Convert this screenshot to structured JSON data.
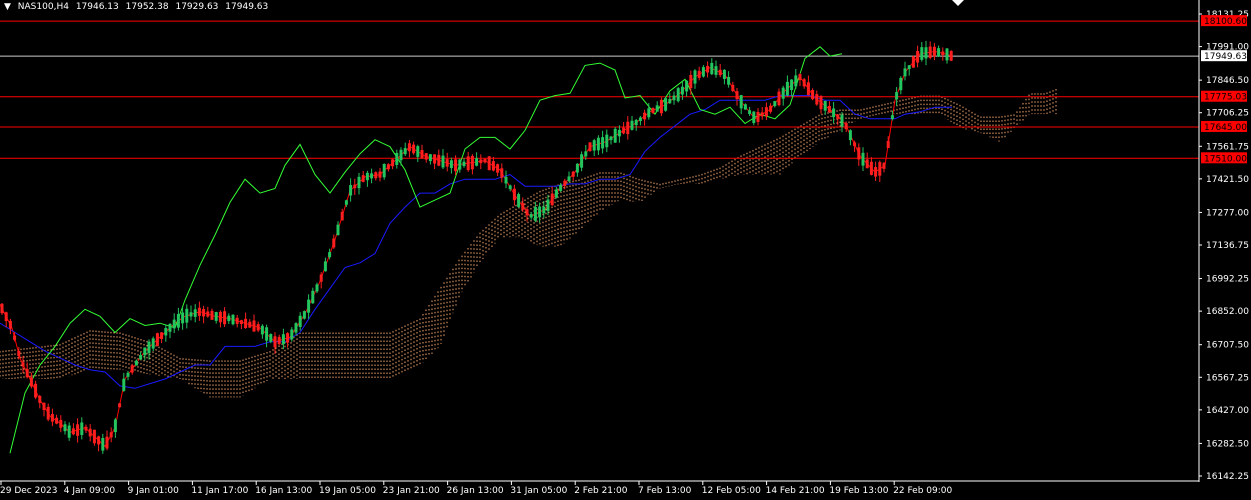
{
  "header": {
    "symbol": "NAS100,H4",
    "open": "17946.13",
    "high": "17952.38",
    "low": "17929.63",
    "close": "17949.63"
  },
  "colors": {
    "background": "#000000",
    "bull": "#22c55e",
    "bear": "#ff1e1e",
    "tenkan": "#ff0000",
    "kijun": "#1a1aff",
    "chikou": "#33ff33",
    "kumo": "#f4a56c",
    "level": "#ff0000",
    "current_price": "#cccccc"
  },
  "chart_data": {
    "type": "line",
    "title": "NAS100,H4",
    "xlabel": "",
    "ylabel": "",
    "ylim": [
      16142.25,
      18131.25
    ],
    "y_ticks": [
      "18131.25",
      "17991.00",
      "17846.50",
      "17706.25",
      "17561.75",
      "17421.50",
      "17277.00",
      "17136.75",
      "16992.25",
      "16852.00",
      "16707.50",
      "16567.25",
      "16427.00",
      "16282.50",
      "16142.25"
    ],
    "x_ticks": [
      "29 Dec 2023",
      "4 Jan 09:00",
      "9 Jan 01:00",
      "11 Jan 17:00",
      "16 Jan 13:00",
      "19 Jan 05:00",
      "23 Jan 21:00",
      "26 Jan 13:00",
      "31 Jan 05:00",
      "2 Feb 21:00",
      "7 Feb 13:00",
      "12 Feb 05:00",
      "14 Feb 21:00",
      "19 Feb 13:00",
      "22 Feb 09:00"
    ],
    "levels": [
      {
        "label": "18100.60",
        "value": 18100.6
      },
      {
        "label": "17775.03",
        "value": 17775.03
      },
      {
        "label": "17645.00",
        "value": 17645.0
      },
      {
        "label": "17510.00",
        "value": 17510.0
      }
    ],
    "current_price": {
      "label": "17949.63",
      "value": 17949.63
    },
    "series": [
      {
        "values": [
          [
            0,
            16880
          ],
          [
            12,
            16780
          ],
          [
            20,
            16650
          ],
          [
            30,
            16560
          ],
          [
            40,
            16470
          ],
          [
            50,
            16400
          ],
          [
            60,
            16370
          ],
          [
            70,
            16330
          ],
          [
            85,
            16350
          ],
          [
            95,
            16310
          ],
          [
            105,
            16270
          ],
          [
            115,
            16350
          ],
          [
            125,
            16560
          ],
          [
            135,
            16620
          ],
          [
            145,
            16680
          ],
          [
            155,
            16720
          ],
          [
            165,
            16760
          ],
          [
            175,
            16800
          ],
          [
            185,
            16830
          ],
          [
            200,
            16850
          ],
          [
            215,
            16830
          ],
          [
            230,
            16820
          ],
          [
            245,
            16800
          ],
          [
            260,
            16780
          ],
          [
            275,
            16720
          ],
          [
            290,
            16740
          ],
          [
            305,
            16840
          ],
          [
            320,
            16980
          ],
          [
            335,
            17160
          ],
          [
            350,
            17370
          ],
          [
            365,
            17430
          ],
          [
            380,
            17440
          ],
          [
            395,
            17500
          ],
          [
            410,
            17560
          ],
          [
            425,
            17520
          ],
          [
            440,
            17500
          ],
          [
            455,
            17480
          ],
          [
            470,
            17490
          ],
          [
            485,
            17500
          ],
          [
            500,
            17460
          ],
          [
            515,
            17350
          ],
          [
            530,
            17260
          ],
          [
            545,
            17290
          ],
          [
            560,
            17380
          ],
          [
            575,
            17450
          ],
          [
            590,
            17560
          ],
          [
            605,
            17580
          ],
          [
            620,
            17620
          ],
          [
            635,
            17660
          ],
          [
            650,
            17710
          ],
          [
            665,
            17740
          ],
          [
            680,
            17790
          ],
          [
            695,
            17860
          ],
          [
            710,
            17900
          ],
          [
            725,
            17870
          ],
          [
            740,
            17760
          ],
          [
            755,
            17680
          ],
          [
            770,
            17720
          ],
          [
            785,
            17800
          ],
          [
            800,
            17860
          ],
          [
            815,
            17770
          ],
          [
            830,
            17720
          ],
          [
            845,
            17660
          ],
          [
            860,
            17520
          ],
          [
            875,
            17450
          ],
          [
            885,
            17480
          ],
          [
            895,
            17760
          ],
          [
            905,
            17880
          ],
          [
            920,
            17960
          ],
          [
            935,
            17970
          ],
          [
            945,
            17960
          ],
          [
            952,
            17950
          ]
        ]
      },
      {
        "values": [
          [
            0,
            16800
          ],
          [
            15,
            16760
          ],
          [
            30,
            16720
          ],
          [
            45,
            16680
          ],
          [
            60,
            16650
          ],
          [
            75,
            16620
          ],
          [
            90,
            16600
          ],
          [
            105,
            16590
          ],
          [
            120,
            16530
          ],
          [
            135,
            16520
          ],
          [
            150,
            16540
          ],
          [
            165,
            16560
          ],
          [
            180,
            16590
          ],
          [
            195,
            16620
          ],
          [
            210,
            16620
          ],
          [
            225,
            16700
          ],
          [
            240,
            16700
          ],
          [
            255,
            16700
          ],
          [
            270,
            16720
          ],
          [
            285,
            16720
          ],
          [
            300,
            16760
          ],
          [
            315,
            16860
          ],
          [
            330,
            16950
          ],
          [
            345,
            17040
          ],
          [
            360,
            17060
          ],
          [
            375,
            17100
          ],
          [
            390,
            17230
          ],
          [
            405,
            17300
          ],
          [
            420,
            17360
          ],
          [
            435,
            17360
          ],
          [
            450,
            17400
          ],
          [
            465,
            17420
          ],
          [
            480,
            17420
          ],
          [
            495,
            17420
          ],
          [
            510,
            17440
          ],
          [
            525,
            17390
          ],
          [
            540,
            17390
          ],
          [
            555,
            17390
          ],
          [
            570,
            17400
          ],
          [
            585,
            17400
          ],
          [
            600,
            17420
          ],
          [
            615,
            17420
          ],
          [
            630,
            17440
          ],
          [
            645,
            17540
          ],
          [
            660,
            17600
          ],
          [
            675,
            17650
          ],
          [
            690,
            17700
          ],
          [
            705,
            17720
          ],
          [
            720,
            17760
          ],
          [
            735,
            17760
          ],
          [
            750,
            17760
          ],
          [
            765,
            17760
          ],
          [
            780,
            17780
          ],
          [
            795,
            17780
          ],
          [
            810,
            17780
          ],
          [
            825,
            17760
          ],
          [
            840,
            17760
          ],
          [
            855,
            17700
          ],
          [
            870,
            17680
          ],
          [
            885,
            17680
          ],
          [
            895,
            17680
          ],
          [
            905,
            17700
          ],
          [
            920,
            17710
          ],
          [
            935,
            17730
          ],
          [
            952,
            17730
          ]
        ]
      },
      {
        "values": [
          [
            10,
            16240
          ],
          [
            25,
            16500
          ],
          [
            40,
            16620
          ],
          [
            55,
            16700
          ],
          [
            70,
            16800
          ],
          [
            85,
            16860
          ],
          [
            100,
            16830
          ],
          [
            115,
            16760
          ],
          [
            130,
            16820
          ],
          [
            145,
            16790
          ],
          [
            160,
            16800
          ],
          [
            175,
            16780
          ],
          [
            185,
            16900
          ],
          [
            200,
            17050
          ],
          [
            215,
            17180
          ],
          [
            230,
            17320
          ],
          [
            245,
            17420
          ],
          [
            260,
            17360
          ],
          [
            275,
            17380
          ],
          [
            285,
            17480
          ],
          [
            300,
            17570
          ],
          [
            315,
            17440
          ],
          [
            330,
            17360
          ],
          [
            345,
            17450
          ],
          [
            360,
            17530
          ],
          [
            375,
            17590
          ],
          [
            390,
            17560
          ],
          [
            405,
            17460
          ],
          [
            420,
            17300
          ],
          [
            435,
            17330
          ],
          [
            450,
            17360
          ],
          [
            465,
            17550
          ],
          [
            480,
            17600
          ],
          [
            495,
            17600
          ],
          [
            510,
            17550
          ],
          [
            525,
            17630
          ],
          [
            540,
            17760
          ],
          [
            555,
            17780
          ],
          [
            570,
            17790
          ],
          [
            585,
            17910
          ],
          [
            600,
            17920
          ],
          [
            615,
            17890
          ],
          [
            625,
            17770
          ],
          [
            640,
            17780
          ],
          [
            655,
            17700
          ],
          [
            670,
            17800
          ],
          [
            685,
            17850
          ],
          [
            700,
            17720
          ],
          [
            715,
            17700
          ],
          [
            730,
            17730
          ],
          [
            745,
            17660
          ],
          [
            760,
            17700
          ],
          [
            775,
            17680
          ],
          [
            790,
            17740
          ],
          [
            805,
            17940
          ],
          [
            820,
            17990
          ],
          [
            830,
            17950
          ],
          [
            842,
            17960
          ]
        ]
      }
    ],
    "kumo_segments": [
      {
        "top": [
          [
            0,
            16680
          ],
          [
            60,
            16710
          ],
          [
            90,
            16770
          ],
          [
            120,
            16760
          ],
          [
            150,
            16720
          ],
          [
            180,
            16650
          ],
          [
            210,
            16640
          ],
          [
            240,
            16640
          ],
          [
            270,
            16680
          ],
          [
            300,
            16760
          ],
          [
            330,
            16760
          ],
          [
            360,
            16760
          ],
          [
            390,
            16760
          ],
          [
            420,
            16820
          ],
          [
            440,
            16950
          ],
          [
            460,
            17080
          ],
          [
            480,
            17190
          ],
          [
            500,
            17270
          ],
          [
            520,
            17320
          ],
          [
            540,
            17370
          ],
          [
            560,
            17400
          ],
          [
            580,
            17420
          ],
          [
            600,
            17450
          ],
          [
            620,
            17450
          ],
          [
            640,
            17420
          ],
          [
            660,
            17400
          ],
          [
            680,
            17420
          ],
          [
            700,
            17440
          ],
          [
            720,
            17470
          ],
          [
            740,
            17520
          ],
          [
            760,
            17560
          ],
          [
            780,
            17600
          ],
          [
            800,
            17650
          ],
          [
            820,
            17700
          ],
          [
            840,
            17720
          ],
          [
            860,
            17720
          ],
          [
            880,
            17740
          ],
          [
            900,
            17760
          ],
          [
            920,
            17780
          ],
          [
            940,
            17780
          ],
          [
            960,
            17740
          ],
          [
            980,
            17690
          ],
          [
            1000,
            17690
          ],
          [
            1015,
            17700
          ],
          [
            1030,
            17790
          ],
          [
            1045,
            17790
          ],
          [
            1057,
            17810
          ]
        ],
        "bottom": [
          [
            0,
            16560
          ],
          [
            60,
            16560
          ],
          [
            90,
            16600
          ],
          [
            120,
            16600
          ],
          [
            150,
            16580
          ],
          [
            180,
            16560
          ],
          [
            210,
            16480
          ],
          [
            240,
            16480
          ],
          [
            270,
            16560
          ],
          [
            300,
            16560
          ],
          [
            330,
            16560
          ],
          [
            360,
            16560
          ],
          [
            390,
            16560
          ],
          [
            420,
            16620
          ],
          [
            440,
            16700
          ],
          [
            460,
            16920
          ],
          [
            480,
            17060
          ],
          [
            500,
            17170
          ],
          [
            520,
            17170
          ],
          [
            540,
            17130
          ],
          [
            560,
            17130
          ],
          [
            580,
            17200
          ],
          [
            600,
            17280
          ],
          [
            620,
            17330
          ],
          [
            640,
            17320
          ],
          [
            660,
            17380
          ],
          [
            680,
            17400
          ],
          [
            700,
            17400
          ],
          [
            720,
            17420
          ],
          [
            740,
            17440
          ],
          [
            760,
            17440
          ],
          [
            780,
            17440
          ],
          [
            800,
            17520
          ],
          [
            820,
            17580
          ],
          [
            840,
            17630
          ],
          [
            860,
            17680
          ],
          [
            880,
            17700
          ],
          [
            900,
            17700
          ],
          [
            920,
            17700
          ],
          [
            940,
            17700
          ],
          [
            960,
            17640
          ],
          [
            980,
            17620
          ],
          [
            1000,
            17580
          ],
          [
            1015,
            17640
          ],
          [
            1030,
            17700
          ],
          [
            1045,
            17700
          ],
          [
            1057,
            17700
          ]
        ]
      }
    ]
  }
}
